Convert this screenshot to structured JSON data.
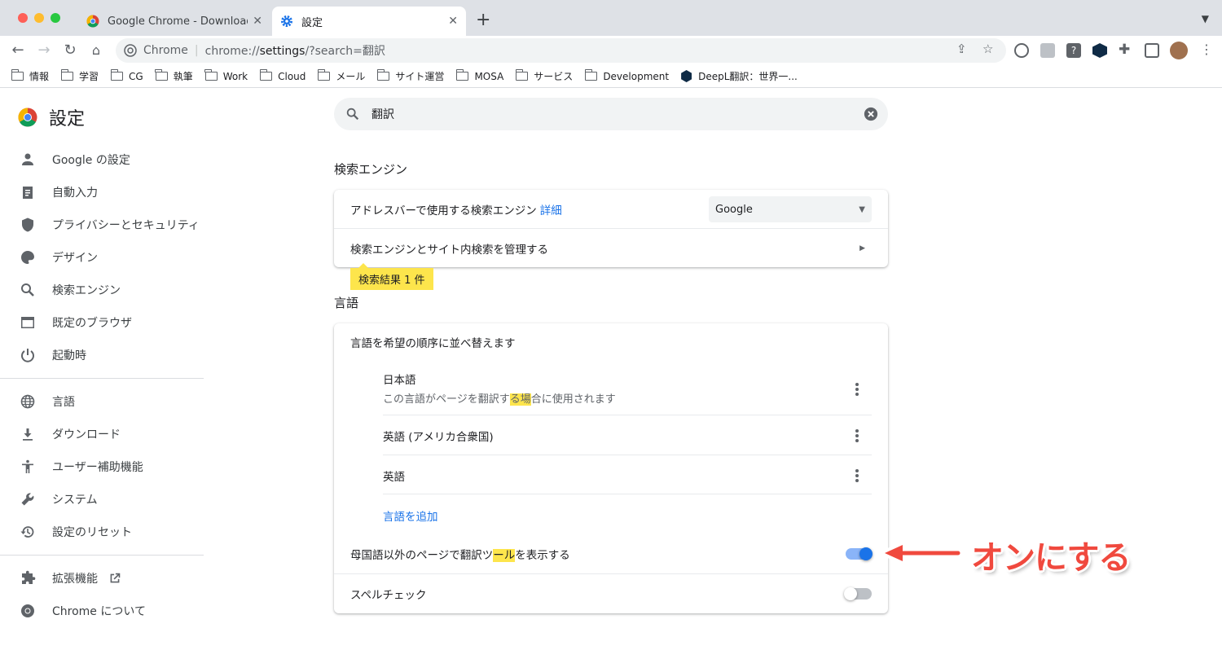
{
  "browser": {
    "tabs": [
      {
        "title": "Google Chrome - Download the"
      },
      {
        "title": "設定"
      }
    ],
    "omnibox": {
      "site": "Chrome",
      "url_prefix": "chrome://",
      "url_host": "settings",
      "url_rest": "/?search=翻訳"
    },
    "bookmarks": [
      "情報",
      "学習",
      "CG",
      "執筆",
      "Work",
      "Cloud",
      "メール",
      "サイト運営",
      "MOSA",
      "サービス",
      "Development",
      "DeepL翻訳：世界一..."
    ]
  },
  "sidebar": {
    "title": "設定",
    "items_main": [
      "Google の設定",
      "自動入力",
      "プライバシーとセキュリティ",
      "デザイン",
      "検索エンジン",
      "既定のブラウザ",
      "起動時"
    ],
    "items_advanced": [
      "言語",
      "ダウンロード",
      "ユーザー補助機能",
      "システム",
      "設定のリセット"
    ],
    "items_footer": [
      "拡張機能",
      "Chrome について"
    ]
  },
  "search": {
    "value": "翻訳"
  },
  "search_engine_section": {
    "title": "検索エンジン",
    "row1_label": "アドレスバーで使用する検索エンジン",
    "row1_link": "詳細",
    "row1_select": "Google",
    "row2_label": "検索エンジンとサイト内検索を管理する"
  },
  "result_badge": "検索結果 1 件",
  "language_section": {
    "title": "言語",
    "order_label": "言語を希望の順序に並べ替えます",
    "languages": [
      {
        "name": "日本語",
        "sub_pre": "この言語がページを翻訳す",
        "sub_hl": "る場",
        "sub_post": "合に使用されます"
      },
      {
        "name": "英語 (アメリカ合衆国)"
      },
      {
        "name": "英語"
      }
    ],
    "add_language": "言語を追加",
    "translate_pre": "母国語以外のページで翻訳ツ",
    "translate_hl": "ール",
    "translate_post": "を表示する",
    "translate_on": true,
    "spellcheck_label": "スペルチェック",
    "spellcheck_on": false
  },
  "annotation": {
    "text": "オンにする"
  },
  "colors": {
    "accent": "#1a73e8",
    "highlight": "#fde54c",
    "annotation": "#f0493e"
  }
}
